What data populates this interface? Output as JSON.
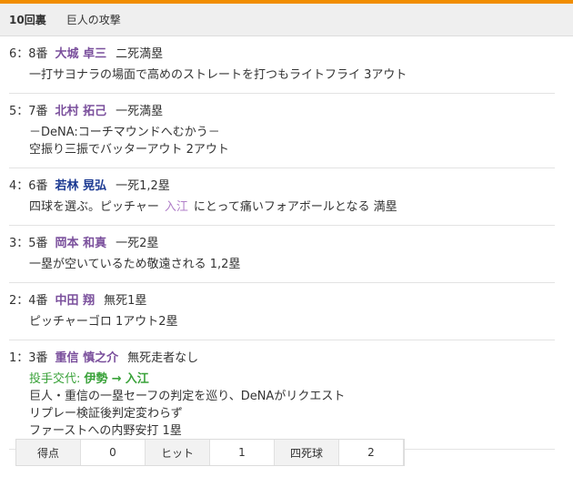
{
  "header": {
    "inning": "10回裏",
    "attack": "巨人の攻撃"
  },
  "events": [
    {
      "num": "6：8番",
      "name": "大城 卓三",
      "name_color": "purple",
      "status": "二死満塁",
      "lines": [
        "一打サヨナラの場面で高めのストレートを打つもライトフライ 3アウト"
      ]
    },
    {
      "num": "5：7番",
      "name": "北村 拓己",
      "name_color": "purple",
      "status": "一死満塁",
      "lines": [
        "－DeNA:コーチマウンドへむかう－",
        "空振り三振でバッターアウト 2アウト"
      ]
    },
    {
      "num": "4：6番",
      "name": "若林 晃弘",
      "name_color": "blue",
      "status": "一死1,2塁",
      "line_parts": {
        "pre": "四球を選ぶ。ピッチャー",
        "pitcher": "入江",
        "post": "にとって痛いフォアボールとなる 満塁"
      }
    },
    {
      "num": "3：5番",
      "name": "岡本 和真",
      "name_color": "purple",
      "status": "一死2塁",
      "lines": [
        "一塁が空いているため敬遠される 1,2塁"
      ]
    },
    {
      "num": "2：4番",
      "name": "中田 翔",
      "name_color": "purple",
      "status": "無死1塁",
      "lines": [
        "ピッチャーゴロ 1アウト2塁"
      ]
    },
    {
      "num": "1：3番",
      "name": "重信 慎之介",
      "name_color": "purple",
      "status": "無死走者なし",
      "change": {
        "label": "投手交代:",
        "from": "伊勢",
        "arrow": "→",
        "to": "入江"
      },
      "lines": [
        "巨人・重信の一塁セーフの判定を巡り、DeNAがリクエスト",
        "リプレー検証後判定変わらず",
        "ファーストへの内野安打 1塁"
      ]
    }
  ],
  "stats": [
    {
      "label": "得点",
      "value": "0"
    },
    {
      "label": "ヒット",
      "value": "1"
    },
    {
      "label": "四死球",
      "value": "2"
    }
  ],
  "colors": {
    "accent": "#f18d00",
    "purple_name": "#7a4f9c",
    "blue_name": "#1c3a92",
    "change_green": "#3aa23a"
  }
}
